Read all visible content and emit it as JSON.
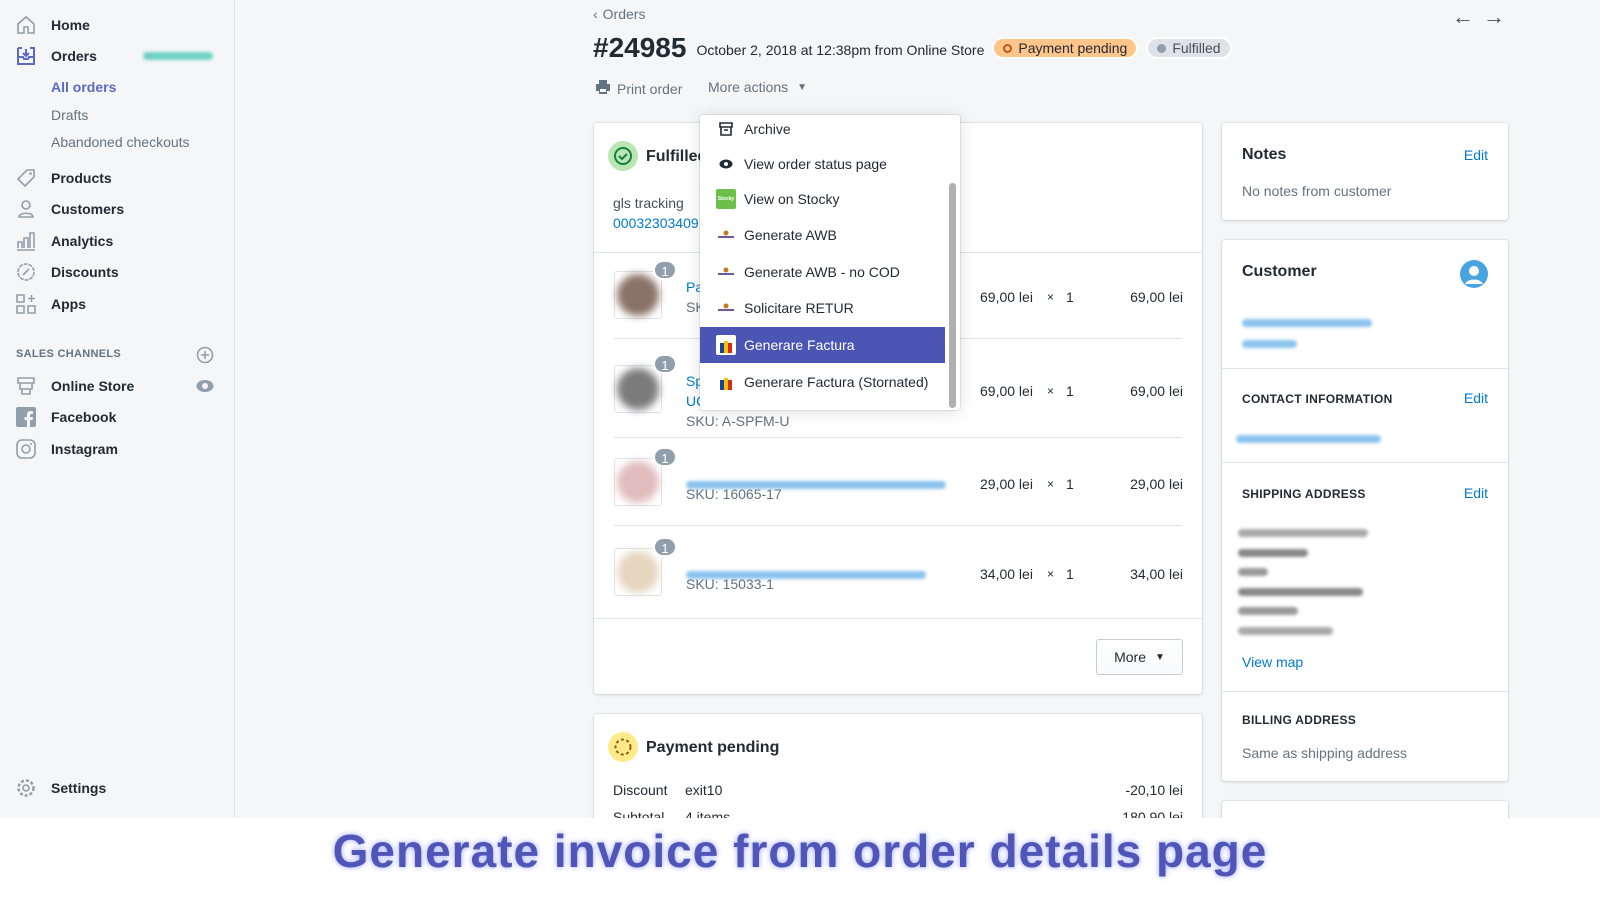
{
  "sidebar": {
    "items": [
      {
        "label": "Home",
        "icon": "home-icon"
      },
      {
        "label": "Orders",
        "icon": "orders-icon"
      },
      {
        "label": "Products",
        "icon": "tag-icon"
      },
      {
        "label": "Customers",
        "icon": "person-icon"
      },
      {
        "label": "Analytics",
        "icon": "bar-chart-icon"
      },
      {
        "label": "Discounts",
        "icon": "discount-icon"
      },
      {
        "label": "Apps",
        "icon": "apps-icon"
      }
    ],
    "orders_sub": [
      "All orders",
      "Drafts",
      "Abandoned checkouts"
    ],
    "sales_channels_title": "SALES CHANNELS",
    "channels": [
      {
        "label": "Online Store",
        "icon": "store-icon"
      },
      {
        "label": "Facebook",
        "icon": "facebook-icon"
      },
      {
        "label": "Instagram",
        "icon": "instagram-icon"
      }
    ],
    "settings": "Settings",
    "accent": "#5c6ac4"
  },
  "header": {
    "back": "Orders",
    "order_number": "#24985",
    "meta": "October 2, 2018 at 12:38pm from Online Store",
    "payment_badge": "Payment pending",
    "fulfillment_badge": "Fulfilled",
    "print": "Print order",
    "more_actions": "More actions"
  },
  "fulfilled": {
    "title": "Fulfilled",
    "tracking_label": "gls tracking",
    "tracking_number": "00032303409",
    "items": [
      {
        "name": "Pa",
        "sku": "SK",
        "price": "69,00 lei",
        "qty": "1",
        "total": "69,00 lei",
        "q": "1",
        "color": "#8a7268"
      },
      {
        "name": "Sp",
        "name2": "UC",
        "sku": "SKU: A-SPFM-U",
        "price": "69,00 lei",
        "qty": "1",
        "total": "69,00 lei",
        "q": "1",
        "color": "#7b7b7b"
      },
      {
        "name": "",
        "sku": "SKU: 16065-17",
        "price": "29,00 lei",
        "qty": "1",
        "total": "29,00 lei",
        "q": "1",
        "color": "#e0bcbc"
      },
      {
        "name": "",
        "sku": "SKU: 15033-1",
        "price": "34,00 lei",
        "qty": "1",
        "total": "34,00 lei",
        "q": "1",
        "color": "#e6d6c0"
      }
    ],
    "times": "×",
    "more": "More"
  },
  "menu": {
    "items": [
      {
        "label": "Archive",
        "icon": "archive-icon"
      },
      {
        "label": "View order status page",
        "icon": "eye-icon"
      },
      {
        "label": "View on Stocky",
        "icon": "stocky-icon"
      },
      {
        "label": "Generate AWB",
        "icon": "courier-icon"
      },
      {
        "label": "Generate AWB - no COD",
        "icon": "courier-icon"
      },
      {
        "label": "Solicitare RETUR",
        "icon": "courier-icon"
      },
      {
        "label": "Generare Factura",
        "icon": "invoice-app-icon",
        "selected": true
      },
      {
        "label": "Generare Factura (Stornated)",
        "icon": "invoice-app-icon"
      }
    ]
  },
  "payment": {
    "title": "Payment pending",
    "rows": [
      {
        "label": "Discount",
        "desc": "exit10",
        "value": "-20,10 lei"
      },
      {
        "label": "Subtotal",
        "desc": "4 items",
        "value": "180,90 lei"
      }
    ]
  },
  "notes": {
    "title": "Notes",
    "edit": "Edit",
    "text": "No notes from customer"
  },
  "customer": {
    "title": "Customer",
    "contact_title": "CONTACT INFORMATION",
    "shipping_title": "SHIPPING ADDRESS",
    "edit": "Edit",
    "view_map": "View map",
    "billing_title": "BILLING ADDRESS",
    "billing_text": "Same as shipping address"
  },
  "caption": "Generate invoice from order details page"
}
